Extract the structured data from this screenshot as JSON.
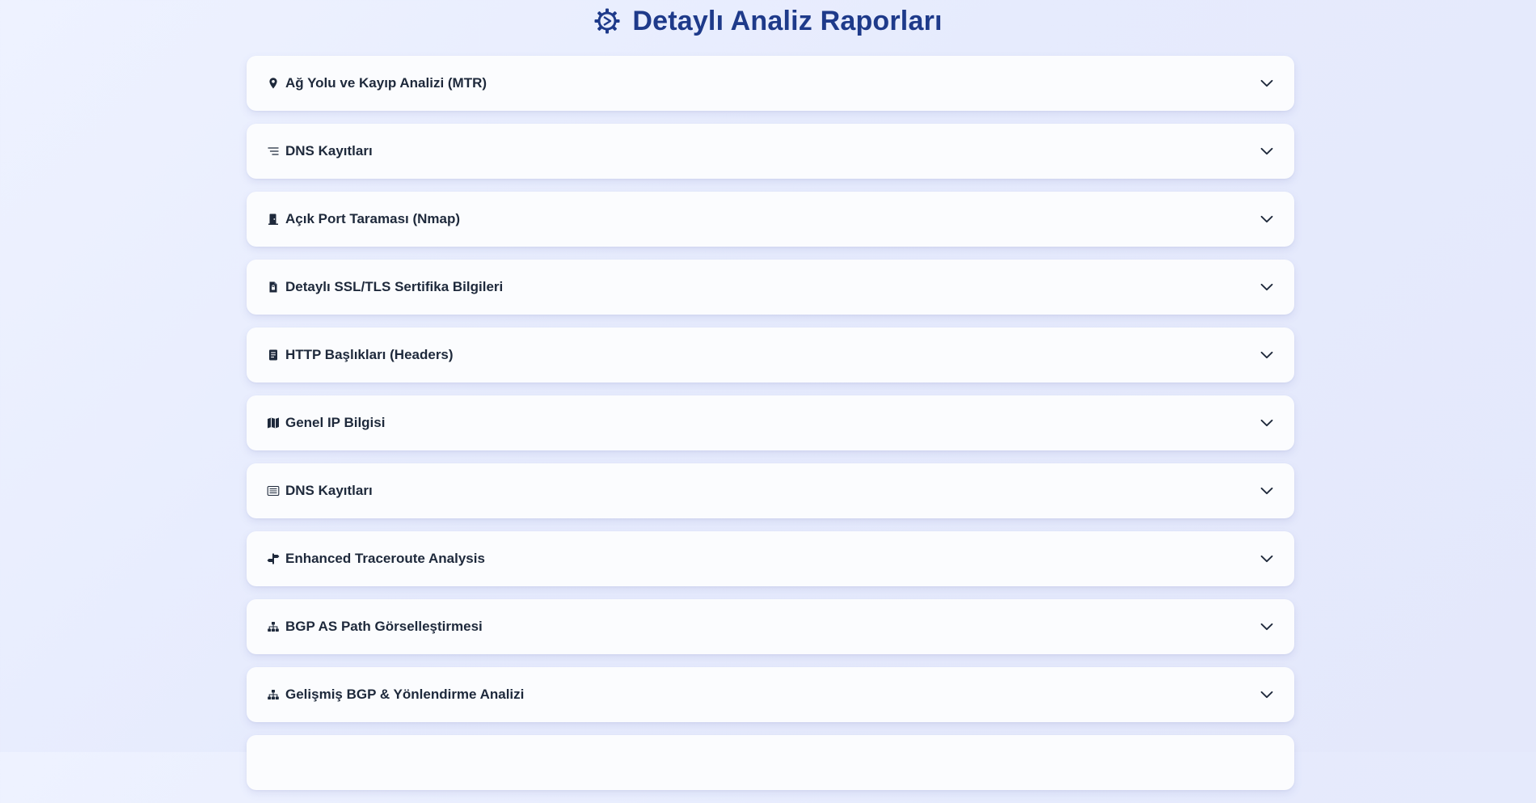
{
  "page": {
    "title": "Detaylı Analiz Raporları",
    "title_icon": "gear-icon"
  },
  "colors": {
    "title": "#1e3a8a",
    "item_text": "#1e293b",
    "item_bg": "#fbfcfe"
  },
  "sections": [
    {
      "label": "Ağ Yolu ve Kayıp Analizi (MTR)",
      "icon": "map-pin-icon"
    },
    {
      "label": "DNS Kayıtları",
      "icon": "list-lines-icon"
    },
    {
      "label": "Açık Port Taraması (Nmap)",
      "icon": "door-icon"
    },
    {
      "label": "Detaylı SSL/TLS Sertifika Bilgileri",
      "icon": "certificate-file-icon"
    },
    {
      "label": "HTTP Başlıkları (Headers)",
      "icon": "document-icon"
    },
    {
      "label": "Genel IP Bilgisi",
      "icon": "map-icon"
    },
    {
      "label": "DNS Kayıtları",
      "icon": "list-box-icon"
    },
    {
      "label": "Enhanced Traceroute Analysis",
      "icon": "signpost-icon"
    },
    {
      "label": "BGP AS Path Görselleştirmesi",
      "icon": "network-tree-icon"
    },
    {
      "label": "Gelişmiş BGP & Yönlendirme Analizi",
      "icon": "network-tree-icon"
    },
    {
      "label": "",
      "icon": ""
    }
  ]
}
